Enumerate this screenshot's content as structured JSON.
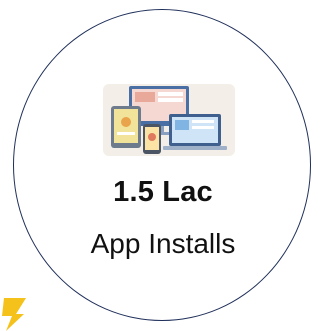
{
  "stat": {
    "value": "1.5 Lac",
    "label": "App Installs"
  },
  "icons": {
    "illustration": "devices-icon",
    "accent": "lightning-bolt-icon"
  },
  "colors": {
    "circle_border": "#1f2f5a",
    "accent": "#f4c21a",
    "text": "#111111"
  }
}
